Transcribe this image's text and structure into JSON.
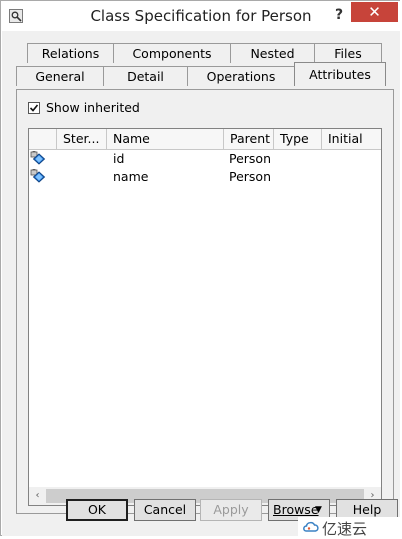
{
  "window": {
    "title": "Class Specification for Person",
    "help_label": "?",
    "close_label": "✕"
  },
  "tabs_row1": [
    {
      "label": "Relations"
    },
    {
      "label": "Components"
    },
    {
      "label": "Nested"
    },
    {
      "label": "Files"
    }
  ],
  "tabs_row2": [
    {
      "label": "General"
    },
    {
      "label": "Detail"
    },
    {
      "label": "Operations"
    },
    {
      "label": "Attributes",
      "active": true
    }
  ],
  "show_inherited": {
    "label": "Show inherited",
    "checked": true
  },
  "table": {
    "columns": [
      "",
      "Ster...",
      "Name",
      "Parent",
      "Type",
      "Initial"
    ],
    "rows": [
      {
        "icon": "attribute-icon",
        "stereotype": "",
        "name": "id",
        "parent": "Person",
        "type": "",
        "initial": ""
      },
      {
        "icon": "attribute-icon",
        "stereotype": "",
        "name": "name",
        "parent": "Person",
        "type": "",
        "initial": ""
      }
    ]
  },
  "scrollbar": {
    "left_arrow": "‹",
    "right_arrow": "›"
  },
  "buttons": {
    "ok": "OK",
    "cancel": "Cancel",
    "apply": "Apply",
    "browse": "Browse",
    "help": "Help"
  },
  "watermark": {
    "text": "亿速云"
  }
}
